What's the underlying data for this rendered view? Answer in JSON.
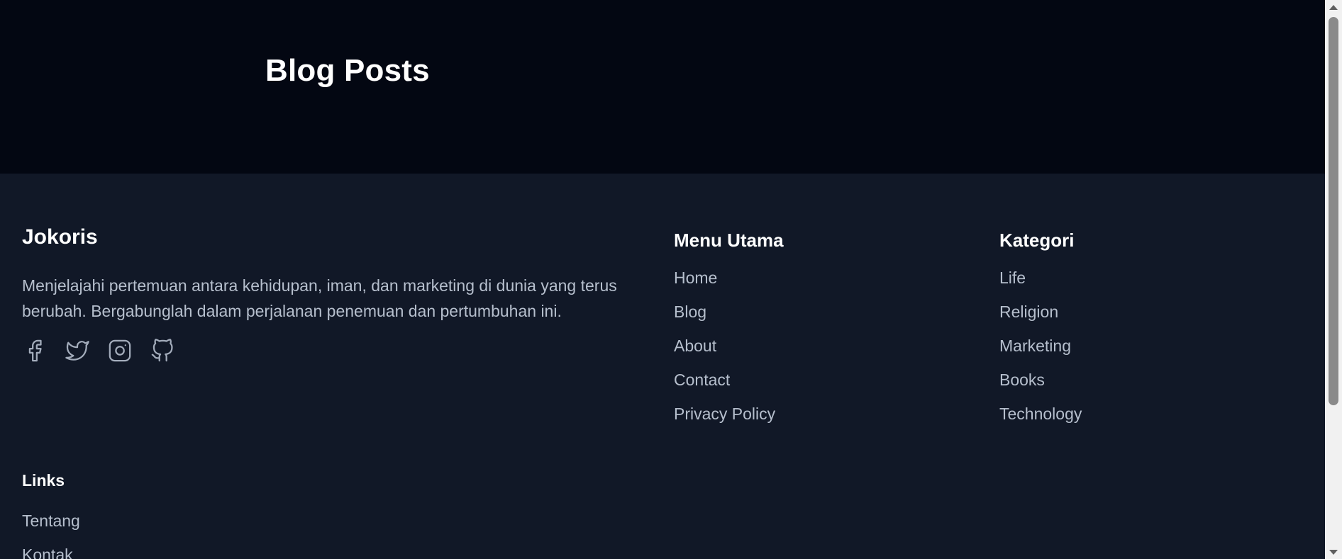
{
  "hero": {
    "title": "Blog Posts"
  },
  "footer": {
    "brand": "Jokoris",
    "description": "Menjelajahi pertemuan antara kehidupan, iman, dan marketing di dunia yang terus berubah. Bergabunglah dalam perjalanan penemuan dan pertumbuhan ini.",
    "socials": [
      "facebook-icon",
      "twitter-icon",
      "instagram-icon",
      "github-icon"
    ],
    "menu_utama": {
      "title": "Menu Utama",
      "items": [
        "Home",
        "Blog",
        "About",
        "Contact",
        "Privacy Policy"
      ]
    },
    "kategori": {
      "title": "Kategori",
      "items": [
        "Life",
        "Religion",
        "Marketing",
        "Books",
        "Technology"
      ]
    },
    "links": {
      "title": "Links",
      "items": [
        "Tentang",
        "Kontak"
      ]
    }
  },
  "colors": {
    "hero_bg": "#030712",
    "footer_bg": "#111827",
    "heading": "#ffffff",
    "text_muted": "#b6bfcd",
    "icon": "#a3acbb"
  }
}
